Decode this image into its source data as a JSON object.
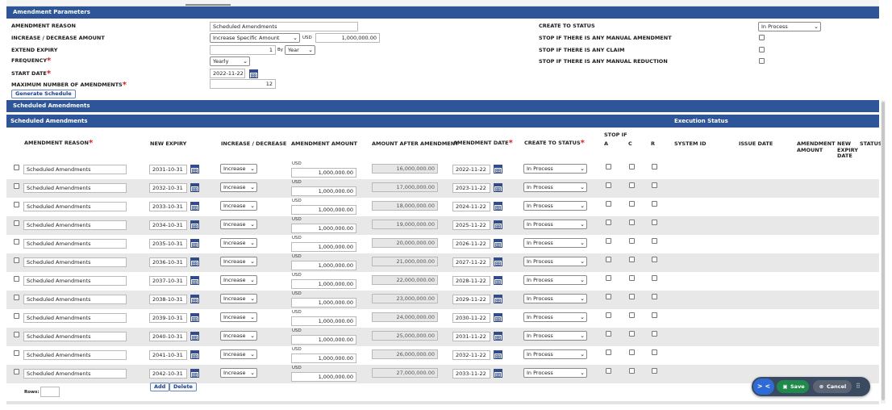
{
  "params": {
    "title": "Amendment Parameters",
    "amendment_reason_label": "AMENDMENT REASON",
    "amendment_reason_value": "Scheduled Amendments",
    "incdec_label": "INCREASE / DECREASE AMOUNT",
    "incdec_value": "Increase Specific Amount",
    "currency": "USD",
    "amount_value": "1,000,000.00",
    "extend_label": "EXTEND EXPIRY",
    "extend_value": "1",
    "by_label": "By",
    "by_value": "Year",
    "frequency_label": "FREQUENCY",
    "frequency_value": "Yearly",
    "start_label": "START DATE",
    "start_value": "2022-11-22",
    "max_label": "MAXIMUM NUMBER OF AMENDMENTS",
    "max_value": "12",
    "generate_label": "Generate Schedule",
    "create_status_label": "CREATE TO STATUS",
    "create_status_value": "In Process",
    "stop_manual_amend_label": "STOP IF THERE IS ANY MANUAL AMENDMENT",
    "stop_claim_label": "STOP IF THERE IS ANY CLAIM",
    "stop_manual_reduction_label": "STOP IF THERE IS ANY MANUAL REDUCTION"
  },
  "schedule": {
    "bar_title": "Scheduled Amendments",
    "subbar_title": "Scheduled Amendments",
    "execution_title": "Execution Status",
    "headers": {
      "reason": "AMENDMENT REASON",
      "new_expiry": "NEW EXPIRY",
      "incdec": "INCREASE / DECREASE",
      "amount": "AMENDMENT AMOUNT",
      "after": "AMOUNT AFTER AMENDMENT",
      "date": "AMENDMENT DATE",
      "status": "CREATE TO STATUS",
      "stop_if": "STOP IF",
      "a": "A",
      "c": "C",
      "r": "R",
      "system_id": "SYSTEM ID",
      "issue_date": "ISSUE DATE",
      "exec_amount_1": "AMENDMENT",
      "exec_amount_2": "AMOUNT",
      "exec_expiry_1": "NEW",
      "exec_expiry_2": "EXPIRY",
      "exec_expiry_3": "DATE",
      "exec_status": "STATUS"
    },
    "rows": [
      {
        "reason": "Scheduled Amendments",
        "expiry": "2031-10-31",
        "incdec": "Increase",
        "currency": "USD",
        "amount": "1,000,000.00",
        "after": "16,000,000.00",
        "date": "2022-11-22",
        "status": "In Process"
      },
      {
        "reason": "Scheduled Amendments",
        "expiry": "2032-10-31",
        "incdec": "Increase",
        "currency": "USD",
        "amount": "1,000,000.00",
        "after": "17,000,000.00",
        "date": "2023-11-22",
        "status": "In Process"
      },
      {
        "reason": "Scheduled Amendments",
        "expiry": "2033-10-31",
        "incdec": "Increase",
        "currency": "USD",
        "amount": "1,000,000.00",
        "after": "18,000,000.00",
        "date": "2024-11-22",
        "status": "In Process"
      },
      {
        "reason": "Scheduled Amendments",
        "expiry": "2034-10-31",
        "incdec": "Increase",
        "currency": "USD",
        "amount": "1,000,000.00",
        "after": "19,000,000.00",
        "date": "2025-11-22",
        "status": "In Process"
      },
      {
        "reason": "Scheduled Amendments",
        "expiry": "2035-10-31",
        "incdec": "Increase",
        "currency": "USD",
        "amount": "1,000,000.00",
        "after": "20,000,000.00",
        "date": "2026-11-22",
        "status": "In Process"
      },
      {
        "reason": "Scheduled Amendments",
        "expiry": "2036-10-31",
        "incdec": "Increase",
        "currency": "USD",
        "amount": "1,000,000.00",
        "after": "21,000,000.00",
        "date": "2027-11-22",
        "status": "In Process"
      },
      {
        "reason": "Scheduled Amendments",
        "expiry": "2037-10-31",
        "incdec": "Increase",
        "currency": "USD",
        "amount": "1,000,000.00",
        "after": "22,000,000.00",
        "date": "2028-11-22",
        "status": "In Process"
      },
      {
        "reason": "Scheduled Amendments",
        "expiry": "2038-10-31",
        "incdec": "Increase",
        "currency": "USD",
        "amount": "1,000,000.00",
        "after": "23,000,000.00",
        "date": "2029-11-22",
        "status": "In Process"
      },
      {
        "reason": "Scheduled Amendments",
        "expiry": "2039-10-31",
        "incdec": "Increase",
        "currency": "USD",
        "amount": "1,000,000.00",
        "after": "24,000,000.00",
        "date": "2030-11-22",
        "status": "In Process"
      },
      {
        "reason": "Scheduled Amendments",
        "expiry": "2040-10-31",
        "incdec": "Increase",
        "currency": "USD",
        "amount": "1,000,000.00",
        "after": "25,000,000.00",
        "date": "2031-11-22",
        "status": "In Process"
      },
      {
        "reason": "Scheduled Amendments",
        "expiry": "2041-10-31",
        "incdec": "Increase",
        "currency": "USD",
        "amount": "1,000,000.00",
        "after": "26,000,000.00",
        "date": "2032-11-22",
        "status": "In Process"
      },
      {
        "reason": "Scheduled Amendments",
        "expiry": "2042-10-31",
        "incdec": "Increase",
        "currency": "USD",
        "amount": "1,000,000.00",
        "after": "27,000,000.00",
        "date": "2033-11-22",
        "status": "In Process"
      }
    ],
    "rows_label": "Rows:",
    "add_label": "Add",
    "delete_label": "Delete"
  },
  "actions": {
    "collapse_label": "> <",
    "save_label": "Save",
    "cancel_label": "Cancel"
  },
  "icons": [
    "calendar-icon",
    "chevron-down-icon",
    "save-icon",
    "cancel-icon",
    "drag-handle-icon"
  ],
  "colors": {
    "section_bar": "#2e5597",
    "required": "#d8221b",
    "save": "#1f8a4c",
    "collapse": "#2f6bd6"
  }
}
